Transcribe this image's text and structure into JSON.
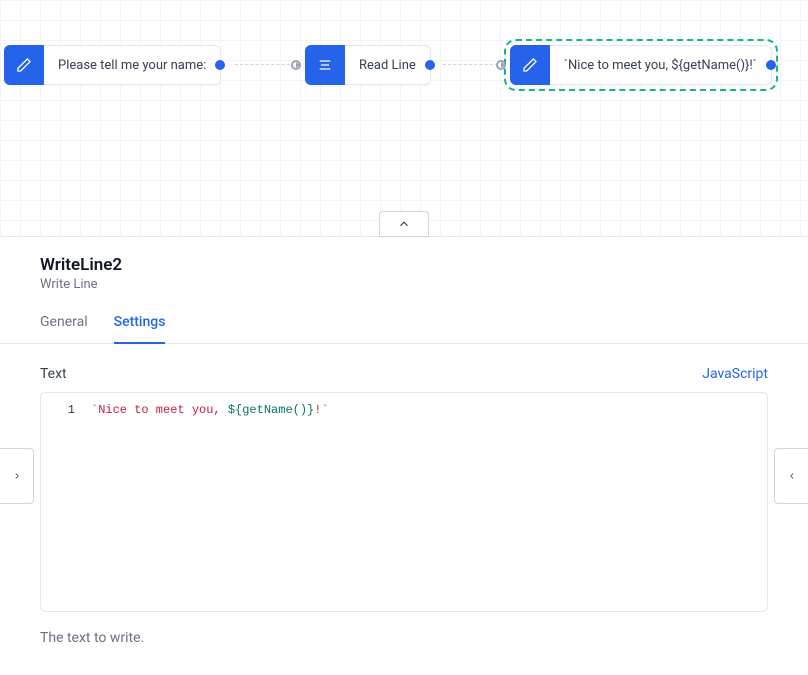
{
  "canvas": {
    "nodes": [
      {
        "id": "n1",
        "icon": "pencil",
        "label": "Please tell me your name:"
      },
      {
        "id": "n2",
        "icon": "lines",
        "label": "Read Line"
      },
      {
        "id": "n3",
        "icon": "pencil",
        "label": "`Nice to meet you, ${getName()}!`"
      }
    ]
  },
  "panel": {
    "title": "WriteLine2",
    "subtitle": "Write Line",
    "tabs": {
      "general": "General",
      "settings": "Settings"
    },
    "field": {
      "label": "Text",
      "language": "JavaScript",
      "lineNumber": "1",
      "code_plain": "`Nice to meet you, ${getName()}!`",
      "help": "The text to write."
    }
  }
}
